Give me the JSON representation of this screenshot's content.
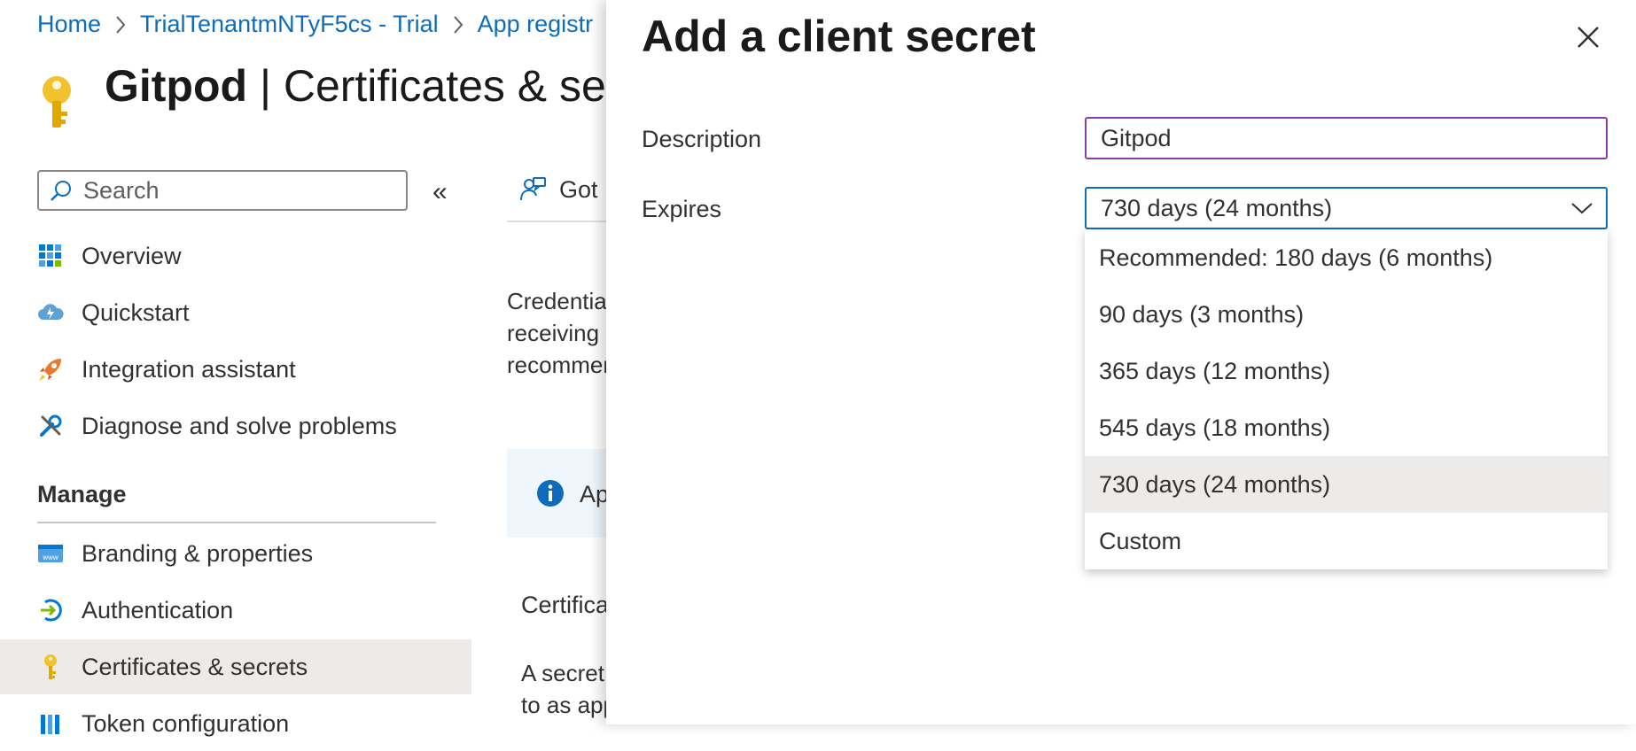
{
  "breadcrumb": {
    "items": [
      "Home",
      "TrialTenantmNTyF5cs - Trial",
      "App registr"
    ]
  },
  "page": {
    "app_name": "Gitpod",
    "separator": " | ",
    "section": "Certificates & secr"
  },
  "sidebar": {
    "search_placeholder": "Search",
    "collapse_glyph": "«",
    "items": [
      {
        "label": "Overview",
        "icon": "overview-grid-icon"
      },
      {
        "label": "Quickstart",
        "icon": "quickstart-cloud-icon"
      },
      {
        "label": "Integration assistant",
        "icon": "rocket-icon"
      },
      {
        "label": "Diagnose and solve problems",
        "icon": "wrench-icon"
      }
    ],
    "manage_header": "Manage",
    "manage_items": [
      {
        "label": "Branding & properties",
        "icon": "www-icon"
      },
      {
        "label": "Authentication",
        "icon": "authentication-icon"
      },
      {
        "label": "Certificates & secrets",
        "icon": "key-icon",
        "selected": true
      },
      {
        "label": "Token configuration",
        "icon": "token-bars-icon"
      }
    ]
  },
  "content": {
    "feedback_label": "Got",
    "credentials_lines": [
      "Credentia",
      "receiving",
      "recommen"
    ],
    "info_text": "Ap",
    "certificates_heading": "Certifica",
    "secret_lines": [
      "A secret",
      "to as app"
    ]
  },
  "panel": {
    "title": "Add a client secret",
    "close_glyph": "close",
    "description_label": "Description",
    "description_value": "Gitpod",
    "expires_label": "Expires",
    "expires_value": "730 days (24 months)",
    "options": [
      "Recommended: 180 days (6 months)",
      "90 days (3 months)",
      "365 days (12 months)",
      "545 days (18 months)",
      "730 days (24 months)",
      "Custom"
    ],
    "selected_option_index": 4
  },
  "colors": {
    "link": "#0f6cbd",
    "focus_border": "#0f6cbd",
    "description_border": "#8a3fa8",
    "selected_bg": "#edebe9",
    "key_gold": "#f2c12e"
  }
}
